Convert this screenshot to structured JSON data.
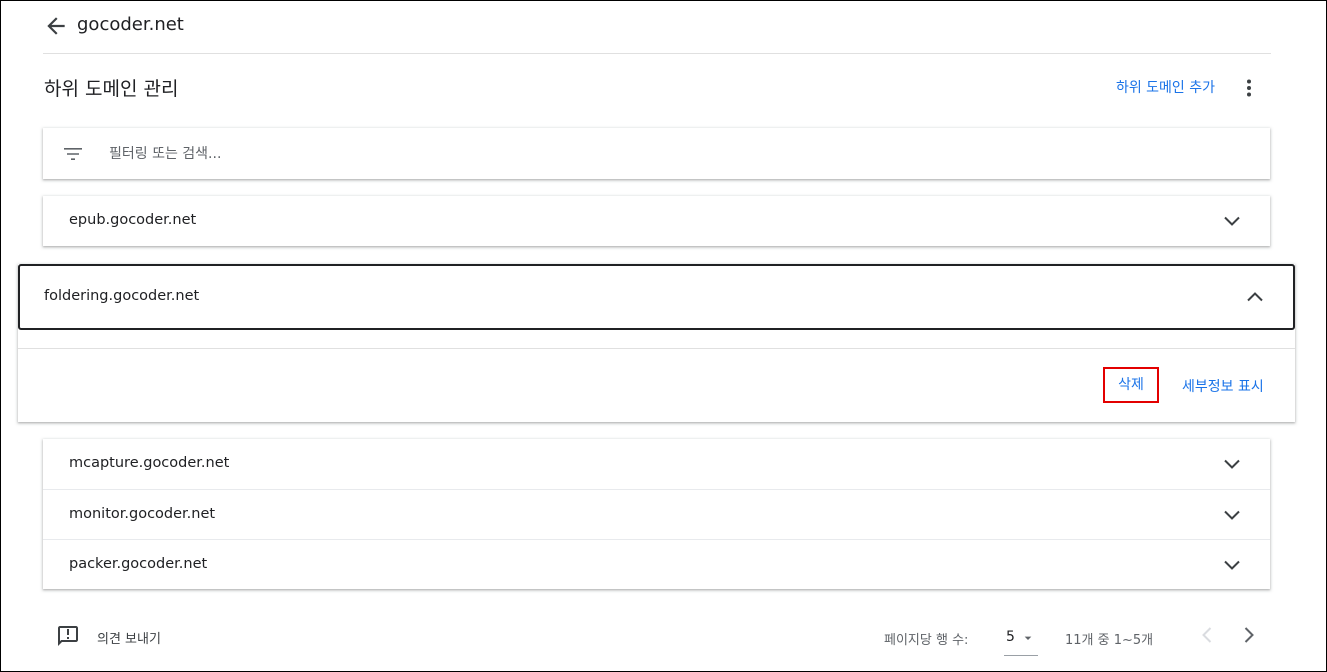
{
  "header": {
    "site_name": "gocoder.net"
  },
  "page": {
    "title": "하위 도메인 관리",
    "add_link": "하위 도메인 추가"
  },
  "filter": {
    "placeholder": "필터링 또는 검색..."
  },
  "subdomains": [
    {
      "name": "epub.gocoder.net",
      "expanded": false
    },
    {
      "name": "foldering.gocoder.net",
      "expanded": true
    },
    {
      "name": "mcapture.gocoder.net",
      "expanded": false
    },
    {
      "name": "monitor.gocoder.net",
      "expanded": false
    },
    {
      "name": "packer.gocoder.net",
      "expanded": false
    }
  ],
  "expanded_actions": {
    "delete": "삭제",
    "details": "세부정보 표시"
  },
  "footer": {
    "feedback": "의견 보내기",
    "rows_per_page_label": "페이지당 행 수:",
    "rows_per_page_value": "5",
    "range": "11개 중 1~5개"
  },
  "colors": {
    "accent": "#1a73e8",
    "highlight_box": "#e30000",
    "text": "#202124",
    "muted": "#5f6368"
  },
  "icons": {
    "back": "arrow-left-icon",
    "more": "more-vert-icon",
    "filter": "filter-list-icon",
    "expand": "chevron-down-icon",
    "collapse": "chevron-up-icon",
    "feedback": "feedback-icon",
    "dropdown": "caret-down-icon",
    "prev": "chevron-left-icon",
    "next": "chevron-right-icon"
  }
}
